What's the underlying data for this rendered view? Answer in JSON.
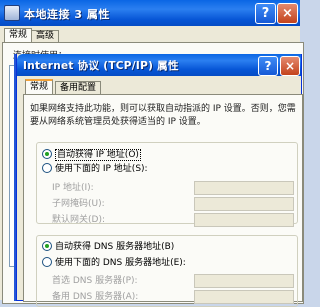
{
  "background_window": {
    "title": "本地连接 3 属性",
    "help_glyph": "?",
    "close_glyph": "×",
    "tabs": [
      "常规",
      "高级"
    ],
    "partial_text": "连接时使用："
  },
  "dialog": {
    "title": "Internet 协议 (TCP/IP) 属性",
    "help_glyph": "?",
    "close_glyph": "×",
    "tabs": [
      {
        "label": "常规",
        "active": true
      },
      {
        "label": "备用配置",
        "active": false
      }
    ],
    "description": "如果网络支持此功能，则可以获取自动指派的 IP 设置。否则，您需要从网络系统管理员处获得适当的 IP 设置。",
    "ip": {
      "auto_label": "自动获得 IP 地址(O)",
      "auto_checked": true,
      "manual_label": "使用下面的 IP 地址(S):",
      "manual_checked": false,
      "fields": [
        {
          "label": "IP 地址(I):",
          "value": ""
        },
        {
          "label": "子网掩码(U):",
          "value": ""
        },
        {
          "label": "默认网关(D):",
          "value": ""
        }
      ]
    },
    "dns": {
      "auto_label": "自动获得 DNS 服务器地址(B)",
      "auto_checked": true,
      "manual_label": "使用下面的 DNS 服务器地址(E):",
      "manual_checked": false,
      "fields": [
        {
          "label": "首选 DNS 服务器(P):",
          "value": ""
        },
        {
          "label": "备用 DNS 服务器(A):",
          "value": ""
        }
      ]
    }
  }
}
